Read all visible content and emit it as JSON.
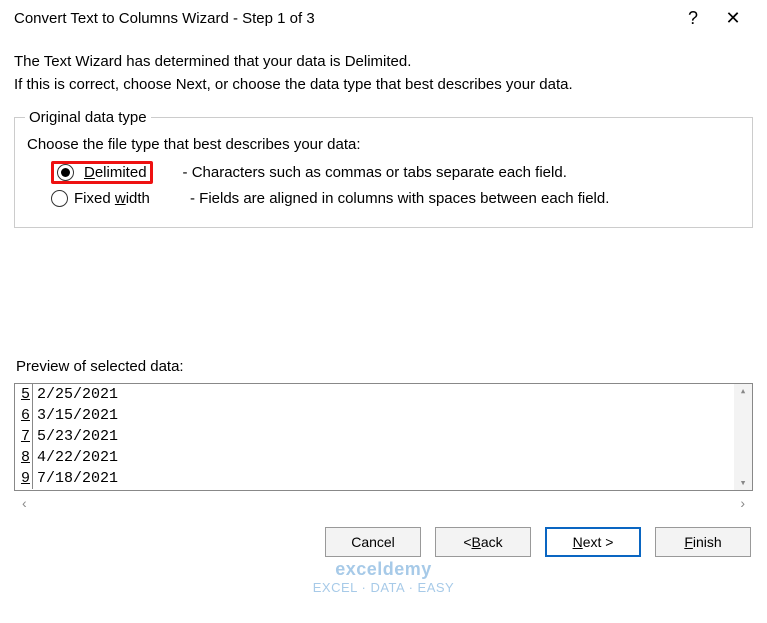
{
  "titlebar": {
    "title": "Convert Text to Columns Wizard - Step 1 of 3",
    "help": "?",
    "close": "✕"
  },
  "intro": {
    "line1": "The Text Wizard has determined that your data is Delimited.",
    "line2": "If this is correct, choose Next, or choose the data type that best describes your data."
  },
  "group": {
    "legend": "Original data type",
    "choose": "Choose the file type that best describes your data:",
    "options": [
      {
        "label_pre": "",
        "label_ul": "D",
        "label_post": "elimited",
        "desc": "- Characters such as commas or tabs separate each field.",
        "selected": true
      },
      {
        "label_pre": "Fixed ",
        "label_ul": "w",
        "label_post": "idth",
        "desc": "- Fields are aligned in columns with spaces between each field.",
        "selected": false
      }
    ]
  },
  "preview": {
    "label": "Preview of selected data:",
    "rows": [
      {
        "n": "5",
        "v": "2/25/2021"
      },
      {
        "n": "6",
        "v": "3/15/2021"
      },
      {
        "n": "7",
        "v": "5/23/2021"
      },
      {
        "n": "8",
        "v": "4/22/2021"
      },
      {
        "n": "9",
        "v": "7/18/2021"
      }
    ]
  },
  "buttons": {
    "cancel": "Cancel",
    "back_pre": "< ",
    "back_ul": "B",
    "back_post": "ack",
    "next_ul": "N",
    "next_post": "ext >",
    "finish_ul": "F",
    "finish_post": "inish"
  },
  "watermark": {
    "brand": "exceldemy",
    "tag": "EXCEL · DATA · EASY"
  }
}
